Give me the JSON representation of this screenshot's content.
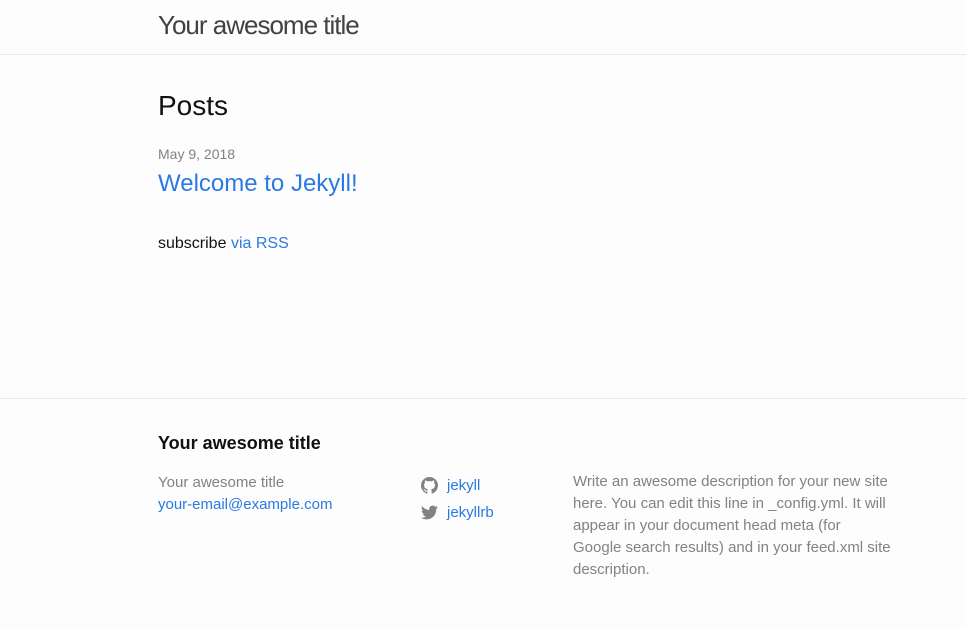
{
  "header": {
    "site_title": "Your awesome title"
  },
  "main": {
    "page_heading": "Posts",
    "posts": [
      {
        "date": "May 9, 2018",
        "title": "Welcome to Jekyll!"
      }
    ],
    "subscribe_prefix": "subscribe",
    "subscribe_link": "via RSS"
  },
  "footer": {
    "heading": "Your awesome title",
    "name": "Your awesome title",
    "email": "your-email@example.com",
    "social": [
      {
        "icon": "github-icon",
        "label": "jekyll"
      },
      {
        "icon": "twitter-icon",
        "label": "jekyllrb"
      }
    ],
    "description": "Write an awesome description for your new site here. You can edit this line in _config.yml. It will appear in your document head meta (for Google search results) and in your feed.xml site description."
  },
  "colors": {
    "link": "#2a7ae2",
    "muted": "#828282",
    "text": "#111111",
    "border": "#e8e8e8",
    "background": "#fdfdfd"
  }
}
